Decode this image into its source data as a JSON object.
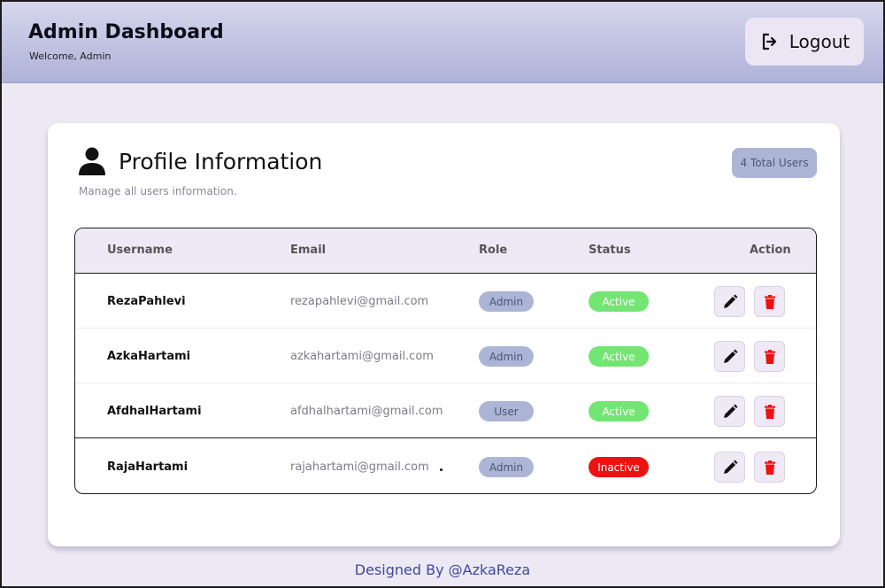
{
  "header": {
    "title": "Admin Dashboard",
    "subtitle": "Welcome, Admin",
    "logout_label": "Logout"
  },
  "card": {
    "title": "Profile Information",
    "subtitle": "Manage all users information.",
    "total_badge": "4 Total Users"
  },
  "table": {
    "columns": [
      "Username",
      "Email",
      "Role",
      "Status",
      "Action"
    ],
    "rows": [
      {
        "username": "RezaPahlevi",
        "email": "rezapahlevi@gmail.com",
        "role": "Admin",
        "status": "Active"
      },
      {
        "username": "AzkaHartami",
        "email": "azkahartami@gmail.com",
        "role": "Admin",
        "status": "Active"
      },
      {
        "username": "AfdhalHartami",
        "email": "afdhalhartami@gmail.com",
        "role": "User",
        "status": "Active"
      },
      {
        "username": "RajaHartami",
        "email": "rajahartami@gmail.com",
        "role": "Admin",
        "status": "Inactive"
      }
    ]
  },
  "footer": {
    "text": "Designed By @AzkaReza"
  },
  "colors": {
    "header_gradient_top": "#d6d6ec",
    "header_gradient_bottom": "#aeb2d8",
    "role_pill": "#adb5d6",
    "status_active": "#73e573",
    "status_inactive": "#ee1111",
    "delete_icon": "#ee1111",
    "footer_text": "#3d4a9a"
  },
  "icons": {
    "logout": "logout-icon",
    "profile": "user-icon",
    "edit": "pencil-icon",
    "delete": "trash-icon"
  }
}
